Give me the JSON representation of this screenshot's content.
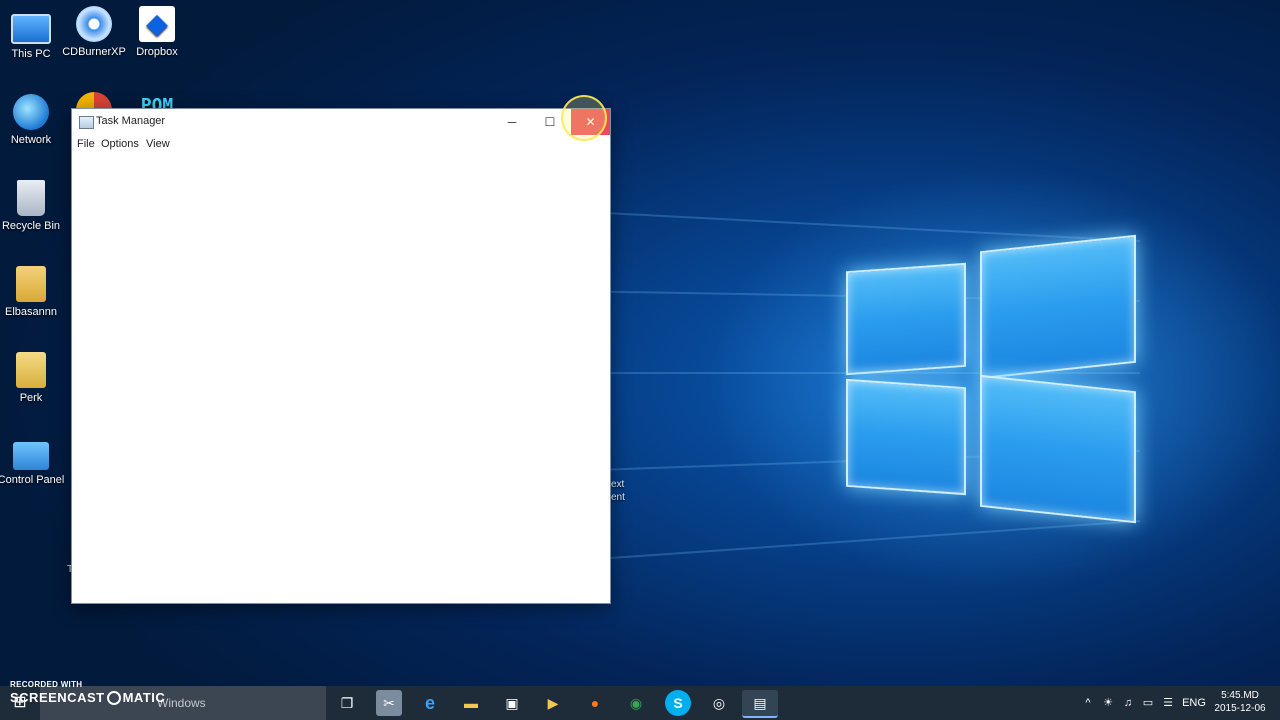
{
  "desktop": {
    "icons": [
      {
        "label": "This PC",
        "icon": "computer-icon"
      },
      {
        "label": "CDBurnerXP",
        "icon": "disc-burner-icon"
      },
      {
        "label": "Dropbox",
        "icon": "dropbox-icon"
      },
      {
        "label": "Network",
        "icon": "network-icon"
      },
      {
        "label": "Recycle Bin",
        "icon": "recycle-bin-icon"
      },
      {
        "label": "Elbasannn",
        "icon": "user-folder-icon"
      },
      {
        "label": "Perk",
        "icon": "folder-icon"
      },
      {
        "label": "Control Panel",
        "icon": "control-panel-icon"
      },
      {
        "label": "",
        "icon": "chrome-icon"
      },
      {
        "label": "POM",
        "icon": "pom-icon"
      }
    ],
    "partial_label_1": "ext",
    "partial_label_2": "ent",
    "partial_label_3": "T"
  },
  "window": {
    "title": "Task Manager",
    "buttons": {
      "minimize": "─",
      "maximize": "☐",
      "close": "✕"
    },
    "menu": [
      "File",
      "Options",
      "View"
    ]
  },
  "taskbar": {
    "start_glyph": "⊞",
    "search_placeholder": "Windows",
    "apps": [
      {
        "icon": "task-view-icon",
        "glyph": "❐"
      },
      {
        "icon": "sniping-icon",
        "glyph": "✂"
      },
      {
        "icon": "edge-icon",
        "glyph": "e"
      },
      {
        "icon": "file-explorer-icon",
        "glyph": "▬"
      },
      {
        "icon": "store-icon",
        "glyph": "▣"
      },
      {
        "icon": "media-player-icon",
        "glyph": "▶"
      },
      {
        "icon": "firefox-icon",
        "glyph": "●"
      },
      {
        "icon": "chrome-icon",
        "glyph": "◉"
      },
      {
        "icon": "skype-icon",
        "glyph": "S"
      },
      {
        "icon": "cd-icon",
        "glyph": "◎"
      },
      {
        "icon": "task-manager-icon",
        "glyph": "▤"
      }
    ],
    "tray": {
      "chevron": "^",
      "language": "ENG",
      "time": "5:45.MD",
      "date": "2015-12-06"
    }
  },
  "watermark": {
    "line1": "RECORDED WITH",
    "line2a": "SCREENCAST",
    "line2b": "MATIC"
  },
  "colors": {
    "close_button": "#e84c5c",
    "taskbar": "#1e2b38",
    "wallpaper_blue": "#0a5cb8"
  }
}
